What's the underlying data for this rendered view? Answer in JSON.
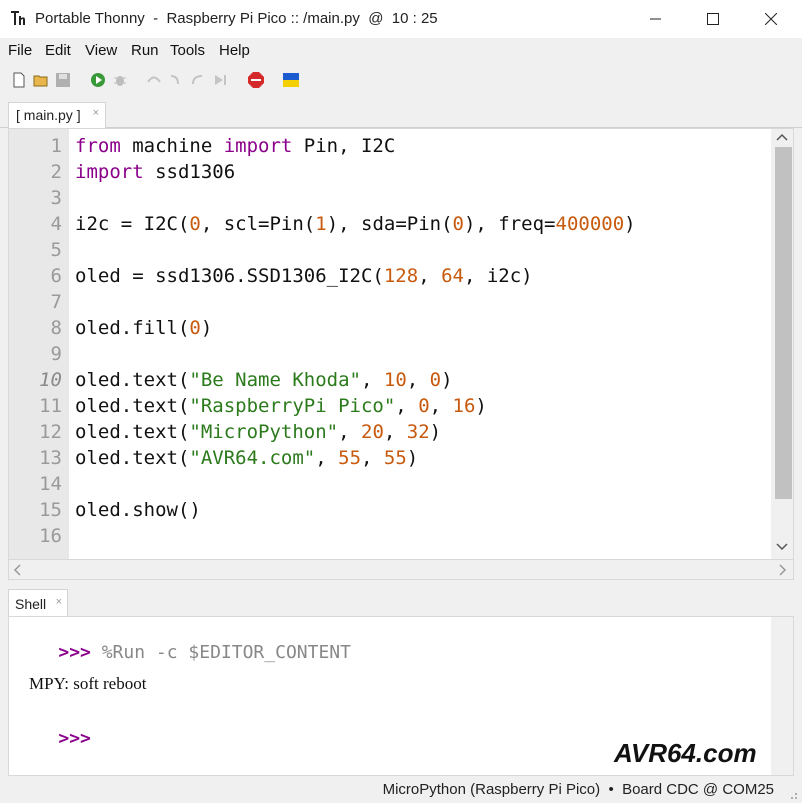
{
  "window": {
    "title": "Portable Thonny  -  Raspberry Pi Pico :: /main.py  @  10 : 25"
  },
  "menu": [
    "File",
    "Edit",
    "View",
    "Run",
    "Tools",
    "Help"
  ],
  "toolbar_icons": [
    "new-file-icon",
    "open-folder-icon",
    "save-icon",
    "run-icon",
    "debug-icon",
    "step-over-icon",
    "step-into-icon",
    "step-out-icon",
    "resume-icon",
    "stop-icon",
    "ukraine-flag-icon"
  ],
  "editor": {
    "tab_label": "[ main.py ]",
    "current_line": 10,
    "lines": [
      "from machine import Pin, I2C",
      "import ssd1306",
      "",
      "i2c = I2C(0, scl=Pin(1), sda=Pin(0), freq=400000)",
      "",
      "oled = ssd1306.SSD1306_I2C(128, 64, i2c)",
      "",
      "oled.fill(0)",
      "",
      "oled.text(\"Be Name Khoda\", 10, 0)",
      "oled.text(\"RaspberryPi Pico\", 0, 16)",
      "oled.text(\"MicroPython\", 20, 32)",
      "oled.text(\"AVR64.com\", 55, 55)",
      "",
      "oled.show()",
      ""
    ]
  },
  "shell": {
    "tab_label": "Shell",
    "prompt": ">>>",
    "command": "%Run -c $EDITOR_CONTENT",
    "output": "MPY: soft reboot"
  },
  "watermark": "AVR64.com",
  "status": "MicroPython (Raspberry Pi Pico)  •  Board CDC @ COM25",
  "colors": {
    "keyword": "#8b008b",
    "number": "#c85a0e",
    "string": "#2b7a1b",
    "gutter": "#e8e8e8"
  }
}
